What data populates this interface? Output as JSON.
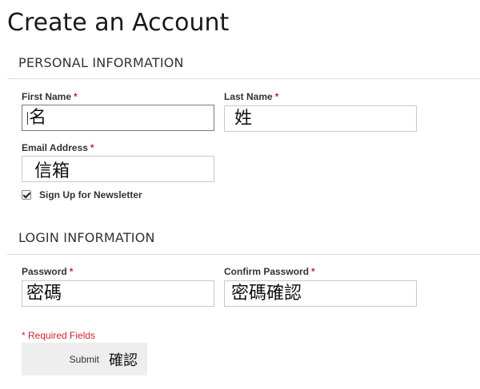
{
  "page": {
    "title": "Create an Account"
  },
  "personal": {
    "heading": "PERSONAL INFORMATION",
    "first_name": {
      "label": "First Name",
      "required_mark": "*",
      "value": "名"
    },
    "last_name": {
      "label": "Last Name",
      "required_mark": "*",
      "value": "姓"
    },
    "email": {
      "label": "Email Address",
      "required_mark": "*",
      "value": "信箱"
    },
    "newsletter": {
      "label": "Sign Up for Newsletter",
      "checked": true
    }
  },
  "login": {
    "heading": "LOGIN INFORMATION",
    "password": {
      "label": "Password",
      "required_mark": "*",
      "value": "密碼"
    },
    "confirm_password": {
      "label": "Confirm Password",
      "required_mark": "*",
      "value": "密碼確認"
    }
  },
  "footer": {
    "required_note": "* Required Fields",
    "submit_label": "Submit",
    "submit_annotation": "確認"
  },
  "colors": {
    "required": "#cc2233",
    "button_bg": "#eeeeee",
    "rule": "#dcdcdc"
  }
}
